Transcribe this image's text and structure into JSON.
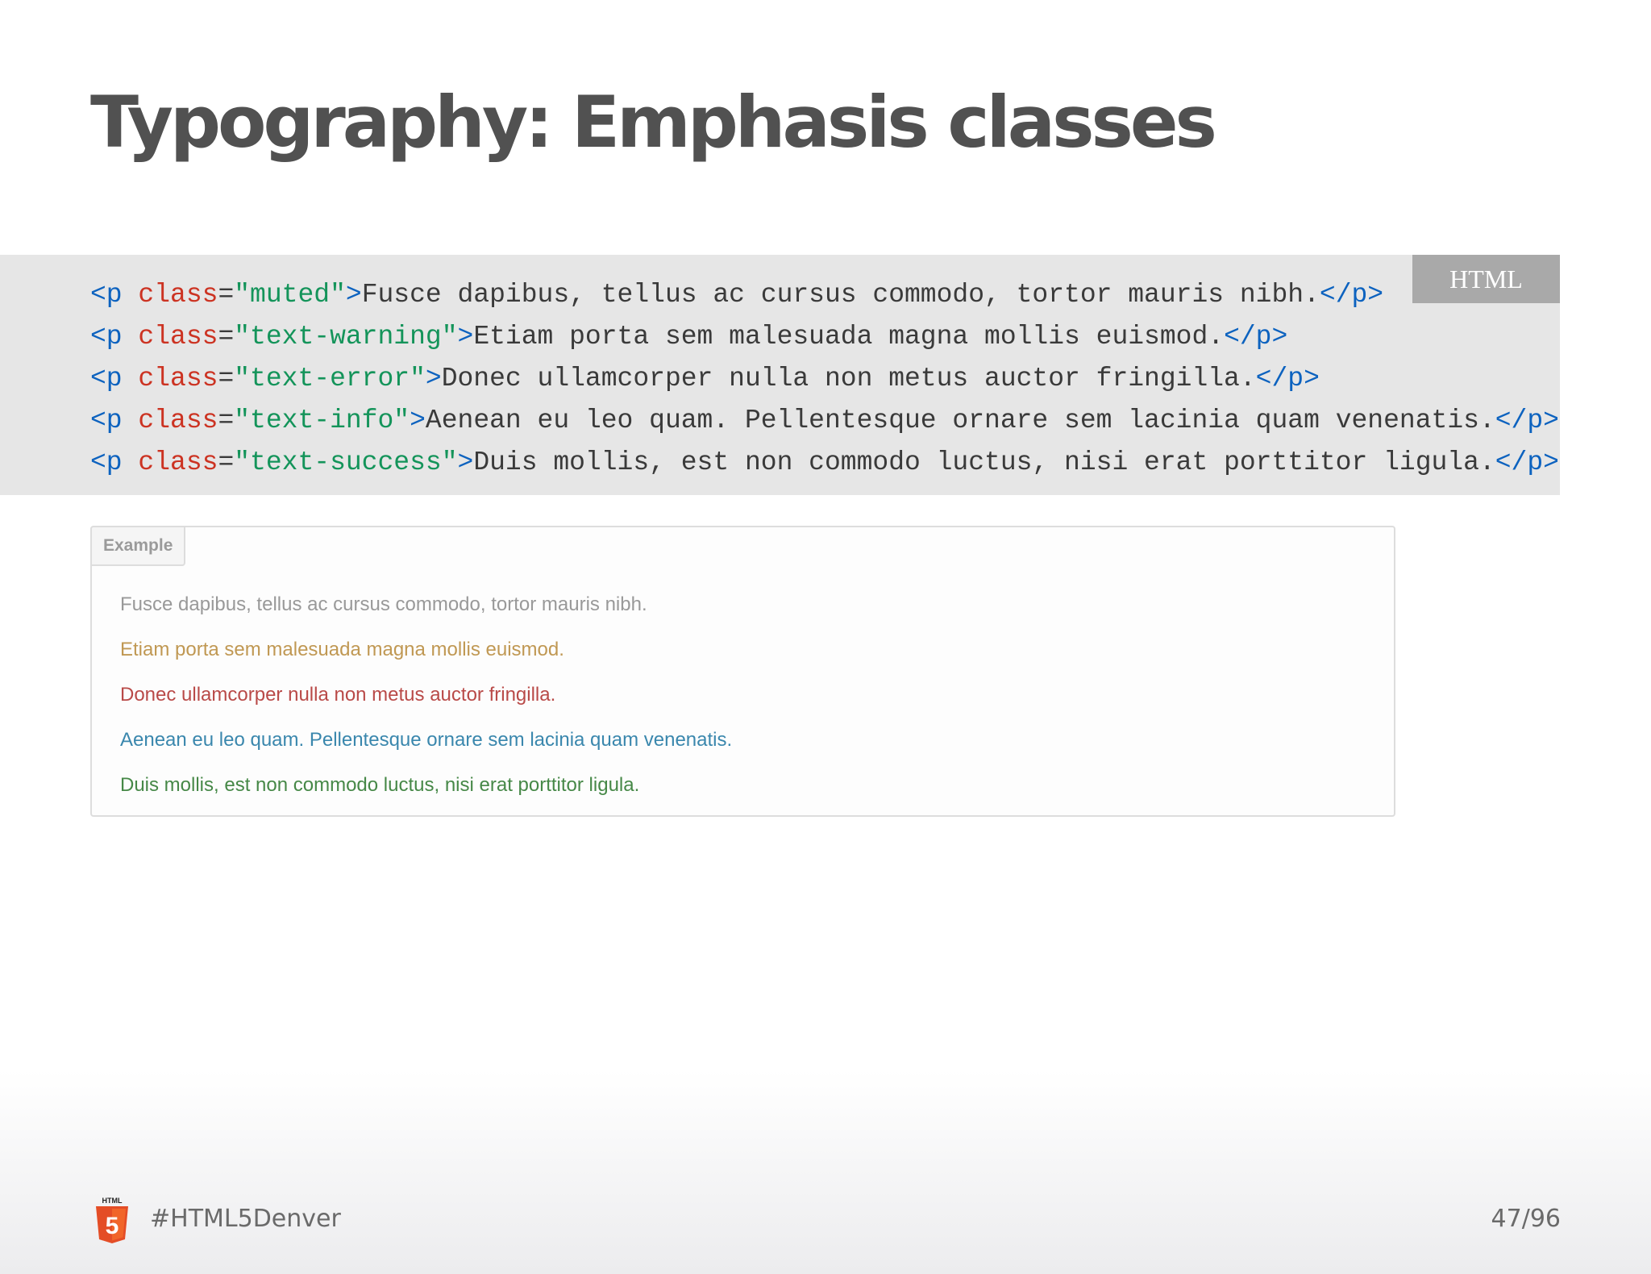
{
  "slide": {
    "title": "Typography: Emphasis classes",
    "code_language": "HTML",
    "code_lines": [
      {
        "tag_open": "<p",
        "attr": " class",
        "eq": "=",
        "value": "\"muted\"",
        "tag_close": ">",
        "text": "Fusce dapibus, tellus ac cursus commodo, tortor mauris nibh.",
        "end_tag": "</p>"
      },
      {
        "tag_open": "<p",
        "attr": " class",
        "eq": "=",
        "value": "\"text-warning\"",
        "tag_close": ">",
        "text": "Etiam porta sem malesuada magna mollis euismod.",
        "end_tag": "</p>"
      },
      {
        "tag_open": "<p",
        "attr": " class",
        "eq": "=",
        "value": "\"text-error\"",
        "tag_close": ">",
        "text": "Donec ullamcorper nulla non metus auctor fringilla.",
        "end_tag": "</p>"
      },
      {
        "tag_open": "<p",
        "attr": " class",
        "eq": "=",
        "value": "\"text-info\"",
        "tag_close": ">",
        "text": "Aenean eu leo quam. Pellentesque ornare sem lacinia quam venenatis.",
        "end_tag": "</p>"
      },
      {
        "tag_open": "<p",
        "attr": " class",
        "eq": "=",
        "value": "\"text-success\"",
        "tag_close": ">",
        "text": "Duis mollis, est non commodo luctus, nisi erat porttitor ligula.",
        "end_tag": "</p>"
      }
    ],
    "example": {
      "label": "Example",
      "lines": [
        "Fusce dapibus, tellus ac cursus commodo, tortor mauris nibh.",
        "Etiam porta sem malesuada magna mollis euismod.",
        "Donec ullamcorper nulla non metus auctor fringilla.",
        "Aenean eu leo quam. Pellentesque ornare sem lacinia quam venenatis.",
        "Duis mollis, est non commodo luctus, nisi erat porttitor ligula."
      ]
    },
    "footer": {
      "logo_icon": "html5-logo-icon",
      "logo_text": "HTML",
      "logo_number": "5",
      "hashtag": "#HTML5Denver",
      "page": "47/96"
    },
    "colors": {
      "title": "#515151",
      "code_tag": "#0c62bf",
      "code_attr": "#cc3322",
      "code_string": "#14945a",
      "muted": "#999999",
      "warning": "#c09853",
      "error": "#b94a48",
      "info": "#3a87ad",
      "success": "#468847",
      "html5_orange": "#e44d26"
    }
  }
}
